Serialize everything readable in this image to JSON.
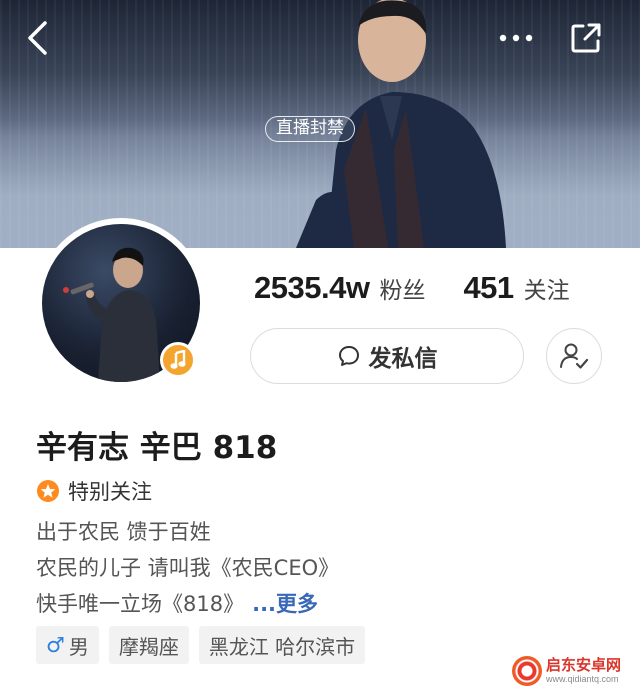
{
  "cover": {
    "live_status": "直播封禁"
  },
  "icons": {
    "back": "chevron-left-icon",
    "more": "more-dots-icon",
    "share": "share-external-icon",
    "music": "music-note-icon",
    "message": "chat-bubble-icon",
    "user_check": "user-check-icon",
    "star": "star-badge-icon",
    "gender": "male-icon"
  },
  "stats": {
    "followers_value": "2535.4w",
    "followers_label": "粉丝",
    "following_value": "451",
    "following_label": "关注"
  },
  "actions": {
    "message_label": "发私信"
  },
  "profile": {
    "name": "辛有志 辛巴 818",
    "special_follow": "特别关注",
    "bio": [
      "出于农民 馈于百姓",
      "农民的儿子  请叫我《农民CEO》",
      "快手唯一立场《818》"
    ],
    "more_label": "...更多"
  },
  "tags": {
    "gender_symbol": "♂",
    "gender": "男",
    "zodiac": "摩羯座",
    "location": "黑龙江 哈尔滨市"
  },
  "watermark": {
    "title": "启东安卓网",
    "url": "www.qidiantq.com"
  },
  "colors": {
    "accent_blue": "#3a68b8",
    "music_badge": "#f3a52f",
    "star_badge": "#ff8a1f",
    "gender_blue": "#2d7fe0"
  }
}
